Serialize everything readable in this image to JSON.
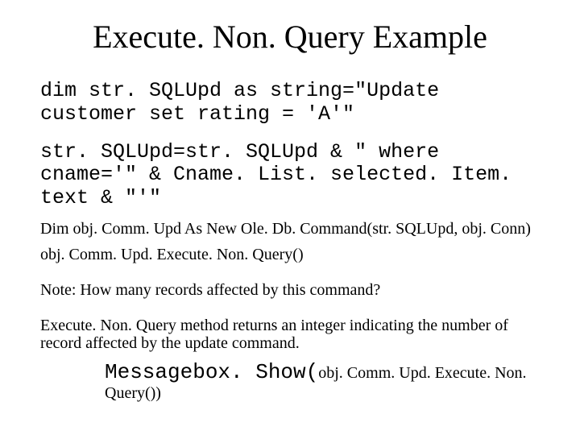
{
  "title": "Execute. Non. Query Example",
  "code_block_1": "dim str. SQLUpd as string=\"Update customer set rating = 'A'\"",
  "code_block_2": "str. SQLUpd=str. SQLUpd & \" where cname='\" & Cname. List. selected. Item. text & \"'\"",
  "line_dim_cmd": "Dim obj. Comm. Upd As New Ole. Db. Command(str. SQLUpd, obj. Conn)",
  "line_exec": "obj. Comm. Upd. Execute. Non. Query()",
  "note": "Note: How many records affected by this command?",
  "explain": "Execute. Non. Query method returns an integer indicating the number of record affected by the update command.",
  "msgbox_mono": "Messagebox. Show(",
  "msgbox_arg": "obj. Comm. Upd. Execute. Non. Query())"
}
